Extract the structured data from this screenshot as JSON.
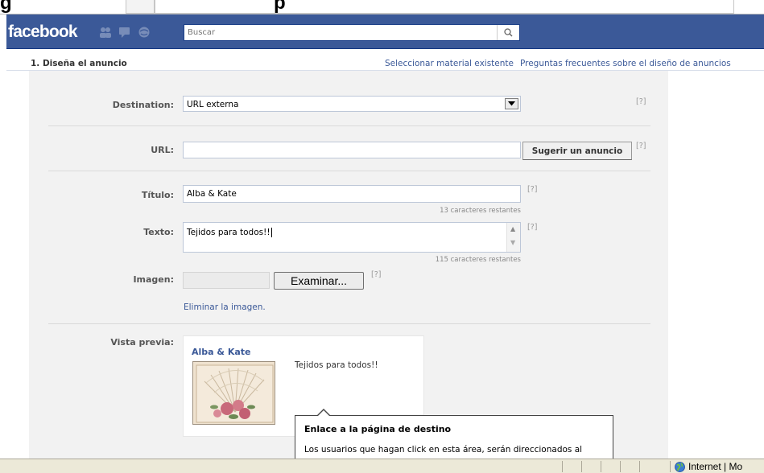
{
  "window": {
    "title_fragment_left": "g",
    "title_fragment_right": "p"
  },
  "colors": {
    "fb_blue": "#3b5998",
    "panel_grey": "#f2f2f2",
    "link_blue": "#3b5998"
  },
  "header": {
    "logo": "facebook",
    "jewels": [
      "friends-icon",
      "messages-icon",
      "notifications-icon"
    ],
    "search": {
      "placeholder": "Buscar",
      "icon": "search-icon"
    }
  },
  "section": {
    "title": "1. Diseña el anuncio",
    "links": {
      "existing": "Seleccionar material existente",
      "faq": "Preguntas frecuentes sobre el diseño de anuncios"
    }
  },
  "form": {
    "help": "[?]",
    "destination": {
      "label": "Destination:",
      "value": "URL externa"
    },
    "url": {
      "label": "URL:",
      "value": "",
      "button": "Sugerir un anuncio"
    },
    "title": {
      "label": "Título:",
      "value": "Alba & Kate",
      "remaining": "13 caracteres restantes"
    },
    "text": {
      "label": "Texto:",
      "value": "Tejidos para todos!!",
      "remaining": "115 caracteres restantes"
    },
    "image": {
      "label": "Imagen:",
      "browse_button": "Examinar...",
      "remove_link": "Eliminar la imagen."
    },
    "preview": {
      "label": "Vista previa:",
      "ad_title": "Alba & Kate",
      "ad_body": "Tejidos para todos!!",
      "image": "lace-fan-with-roses-image"
    }
  },
  "tooltip": {
    "title": "Enlace a la página de destino",
    "body": "Los usuarios que hagan click en esta área, serán direccionados al"
  },
  "statusbar": {
    "zone": "Internet | Mo",
    "zone_icon": "globe-icon"
  }
}
